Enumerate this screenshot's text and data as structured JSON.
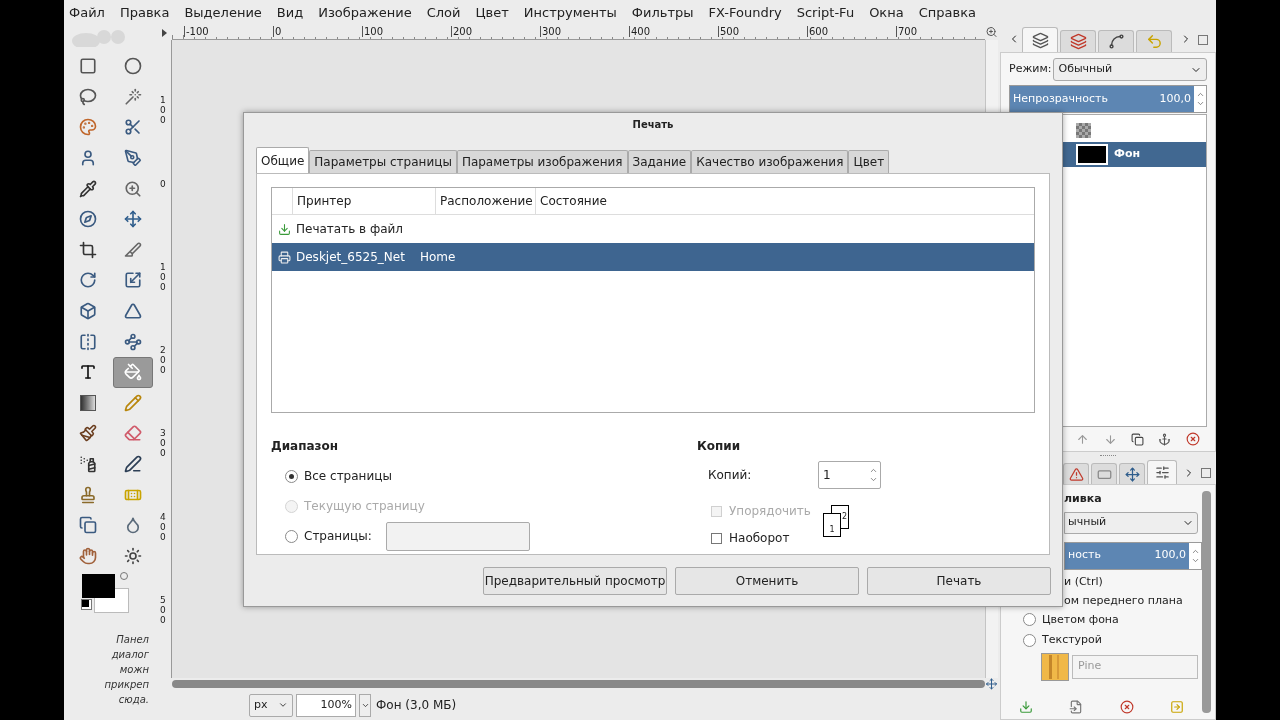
{
  "menu": [
    "Файл",
    "Правка",
    "Выделение",
    "Вид",
    "Изображение",
    "Слой",
    "Цвет",
    "Инструменты",
    "Фильтры",
    "FX-Foundry",
    "Script-Fu",
    "Окна",
    "Справка"
  ],
  "rulers": {
    "horizontal": [
      "-100",
      "0",
      "100",
      "200",
      "300",
      "400",
      "500",
      "600",
      "700"
    ],
    "vertical": [
      "100",
      "0",
      "100",
      "200",
      "300",
      "400",
      "500"
    ]
  },
  "toolbox": {
    "tools": [
      {
        "selected": false
      },
      {
        "selected": false
      },
      {
        "selected": false
      },
      {
        "selected": false
      },
      {
        "selected": false
      },
      {
        "selected": false
      },
      {
        "selected": false
      },
      {
        "selected": false
      },
      {
        "selected": false
      },
      {
        "selected": false
      },
      {
        "selected": false
      },
      {
        "selected": false
      },
      {
        "selected": false
      },
      {
        "selected": false
      },
      {
        "selected": false
      },
      {
        "selected": false
      },
      {
        "selected": false
      },
      {
        "selected": false
      },
      {
        "selected": false
      },
      {
        "selected": false
      },
      {
        "selected": false
      },
      {
        "selected": true
      },
      {
        "selected": false
      },
      {
        "selected": false
      },
      {
        "selected": false
      },
      {
        "selected": false
      },
      {
        "selected": false
      },
      {
        "selected": false
      },
      {
        "selected": false
      },
      {
        "selected": false
      },
      {
        "selected": false
      },
      {
        "selected": false
      },
      {
        "selected": false
      },
      {
        "selected": false
      }
    ],
    "dock_hint": [
      "Панел",
      "диалог",
      "можн",
      "прикреп",
      "сюда."
    ]
  },
  "status_bar": {
    "unit": "px",
    "zoom": "100%",
    "info": "Фон (3,0 МБ)"
  },
  "layers_panel": {
    "tabs": [
      {
        "selected": true
      },
      {
        "selected": false
      },
      {
        "selected": false
      },
      {
        "selected": false
      }
    ],
    "mode_label": "Режим:",
    "mode": "Обычный",
    "opacity": {
      "label": "Непрозрачность",
      "value": "100,0",
      "level": 1
    },
    "layers": [
      {
        "name": "Фон",
        "selected": true
      }
    ]
  },
  "tool_options_panel": {
    "tabs": [
      {
        "selected": false
      },
      {
        "selected": false
      },
      {
        "selected": false
      },
      {
        "selected": true
      }
    ],
    "title": "ливка",
    "mode": "ычный",
    "opacity": {
      "label": "ность",
      "value": "100,0",
      "level": 1
    },
    "lines": [
      "и (Ctrl)",
      "ом переднего плана"
    ],
    "fill_options": [
      {
        "label": "Цветом фона",
        "selected": false
      },
      {
        "label": "Текстурой",
        "selected": false
      }
    ],
    "pattern": "Pine"
  },
  "print_dialog": {
    "title": "Печать",
    "tabs": [
      {
        "label": "Общие",
        "selected": true
      },
      {
        "label": "Параметры страницы",
        "selected": false
      },
      {
        "label": "Параметры изображения",
        "selected": false
      },
      {
        "label": "Задание",
        "selected": false
      },
      {
        "label": "Качество изображения",
        "selected": false
      },
      {
        "label": "Цвет",
        "selected": false
      }
    ],
    "columns": [
      "Принтер",
      "Расположение",
      "Состояние"
    ],
    "printers": [
      {
        "kind": "file",
        "name": "Печатать в файл",
        "selected": false
      },
      {
        "kind": "printer",
        "name": "Deskjet_6525_Net",
        "location": "Home",
        "selected": true
      }
    ],
    "range": {
      "title": "Диапазон",
      "options": [
        {
          "kind": "radio",
          "label": "Все страницы",
          "selected": true,
          "disabled": false
        },
        {
          "kind": "radio",
          "label": "Текущую страницу",
          "selected": false,
          "disabled": true
        },
        {
          "kind": "radio_with_field",
          "label": "Страницы:",
          "selected": false,
          "disabled": false
        }
      ]
    },
    "copies": {
      "title": "Копии",
      "label": "Копий:",
      "value": "1",
      "options": [
        {
          "label": "Упорядочить",
          "checked": false,
          "disabled": true
        },
        {
          "label": "Наоборот",
          "checked": false,
          "disabled": false
        }
      ],
      "pages": [
        "1",
        "2"
      ]
    },
    "buttons": [
      "Предварительный просмотр",
      "Отменить",
      "Печать"
    ]
  }
}
